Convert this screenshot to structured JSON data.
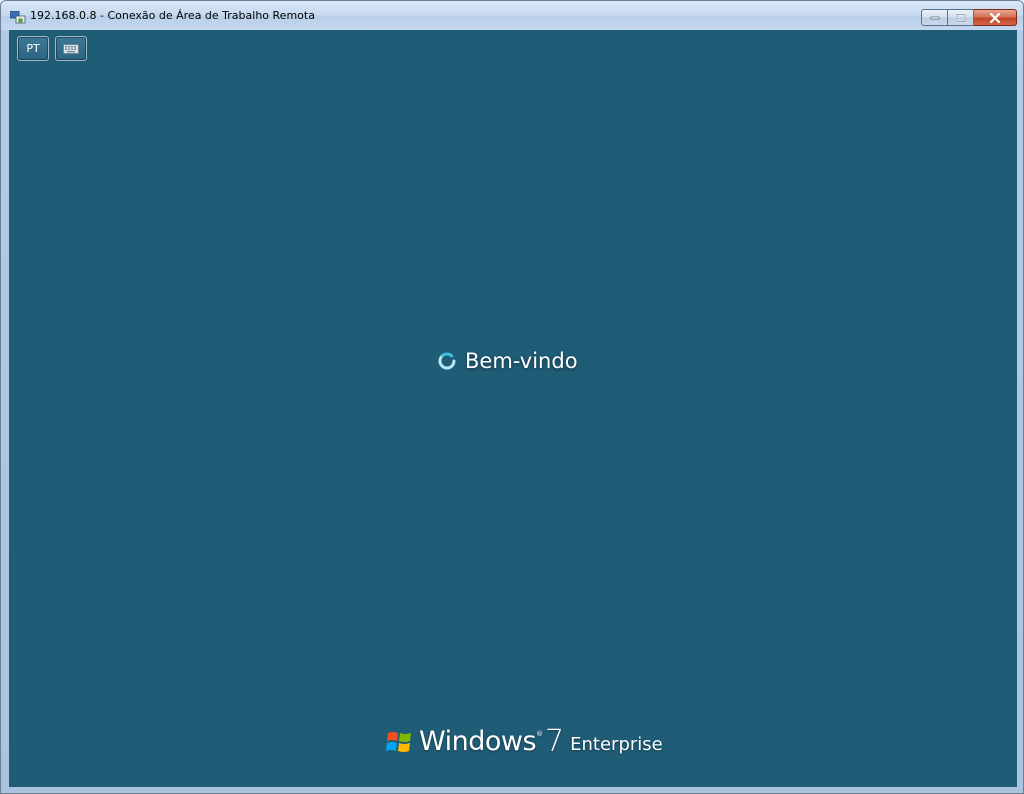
{
  "window": {
    "title": "192.168.0.8 - Conexão de Área de Trabalho Remota",
    "icon": "remote-desktop-icon"
  },
  "caption_buttons": {
    "minimize": "minimize-icon",
    "maximize": "maximize-icon",
    "close": "close-icon"
  },
  "toolbar": {
    "language_label": "PT",
    "keyboard_icon": "keyboard-icon"
  },
  "login": {
    "welcome_text": "Bem-vindo",
    "spinner_icon": "loading-spinner-icon"
  },
  "branding": {
    "product": "Windows",
    "version": "7",
    "edition": "Enterprise",
    "logo_icon": "windows-flag-icon"
  },
  "colors": {
    "desktop_background": "#1f5c76",
    "title_bar": "#c6d9ef",
    "close_button": "#c2452a"
  }
}
